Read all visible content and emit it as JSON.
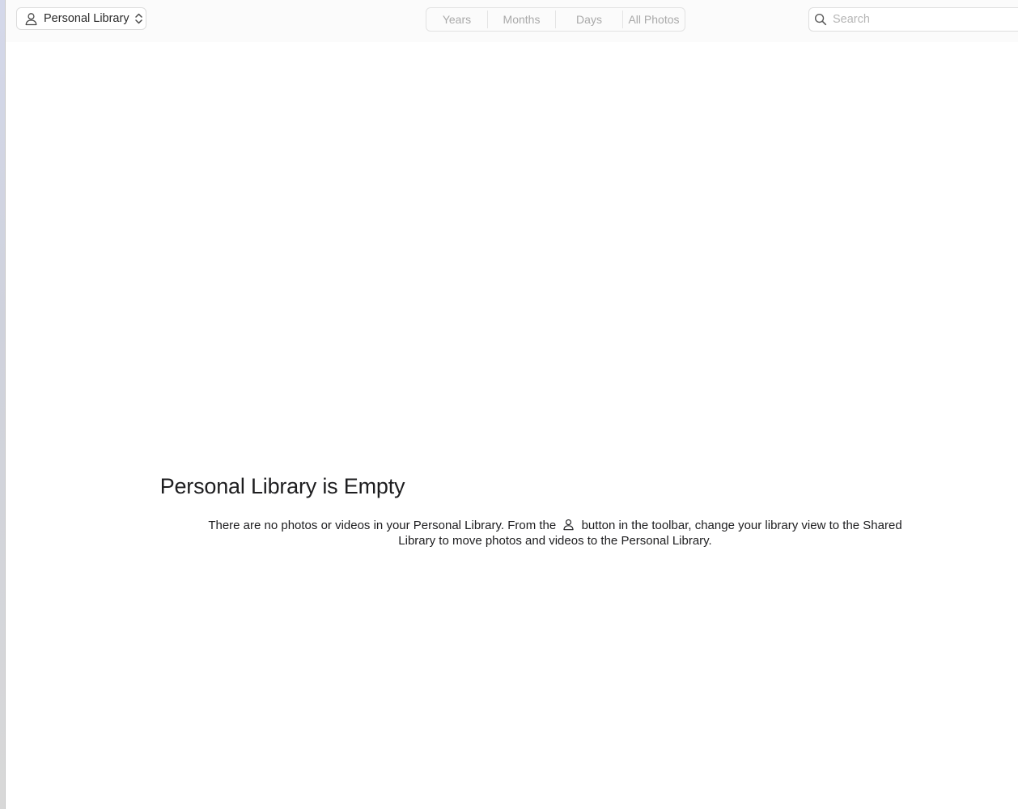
{
  "toolbar": {
    "library_picker": {
      "label": "Personal Library",
      "icon": "person-icon",
      "chevron_icon": "chevron-updown-icon"
    },
    "view_segments": [
      {
        "label": "Years"
      },
      {
        "label": "Months"
      },
      {
        "label": "Days"
      },
      {
        "label": "All Photos"
      }
    ],
    "search": {
      "placeholder": "Search",
      "value": "",
      "icon": "search-icon"
    }
  },
  "empty_state": {
    "title": "Personal Library is Empty",
    "message_part1": "There are no photos or videos in your Personal Library. From the",
    "message_icon": "person-icon",
    "message_part2": "button in the toolbar, change your library view to the Shared Library to move photos and videos to the Personal Library."
  }
}
